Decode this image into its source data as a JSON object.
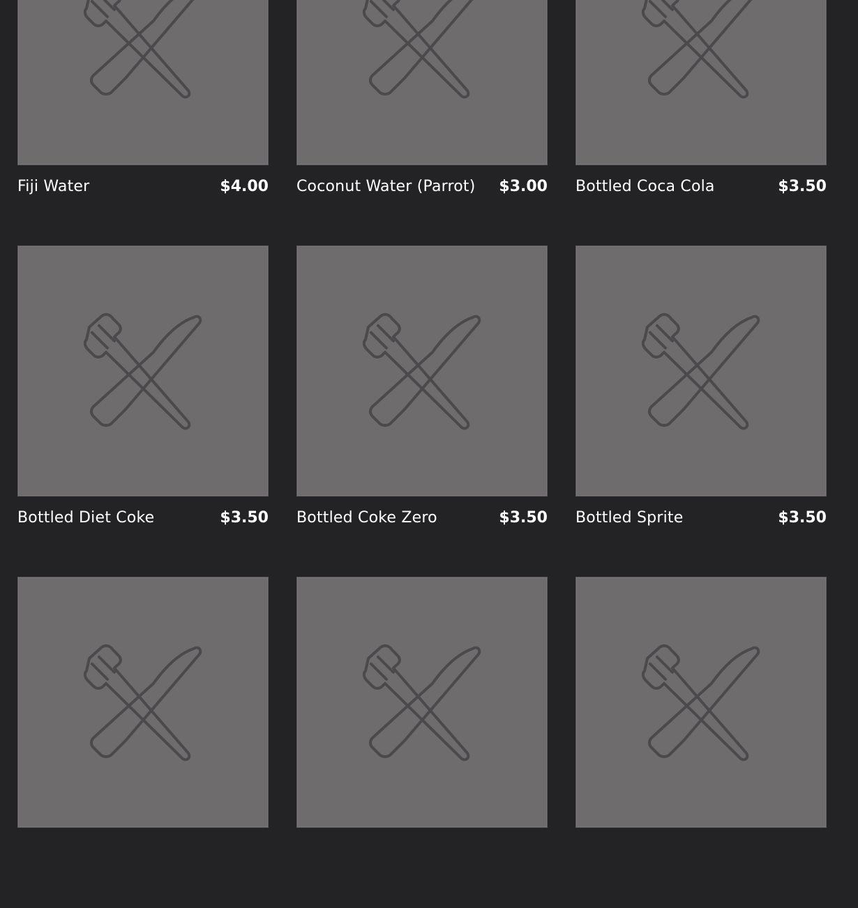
{
  "menu": {
    "items": [
      {
        "name": "Fiji Water",
        "price": "$4.00",
        "image_icon": "fork-knife-icon"
      },
      {
        "name": "Coconut Water (Parrot)",
        "price": "$3.00",
        "image_icon": "fork-knife-icon"
      },
      {
        "name": "Bottled Coca Cola",
        "price": "$3.50",
        "image_icon": "fork-knife-icon"
      },
      {
        "name": "Bottled Diet Coke",
        "price": "$3.50",
        "image_icon": "fork-knife-icon"
      },
      {
        "name": "Bottled Coke Zero",
        "price": "$3.50",
        "image_icon": "fork-knife-icon"
      },
      {
        "name": "Bottled Sprite",
        "price": "$3.50",
        "image_icon": "fork-knife-icon"
      },
      {
        "name": "",
        "price": "",
        "image_icon": "fork-knife-icon"
      },
      {
        "name": "",
        "price": "",
        "image_icon": "fork-knife-icon"
      },
      {
        "name": "",
        "price": "",
        "image_icon": "fork-knife-icon"
      }
    ]
  },
  "colors": {
    "background": "#232224",
    "placeholder": "#6e6c6d",
    "icon_stroke": "#4a494b",
    "text": "#ffffff"
  }
}
